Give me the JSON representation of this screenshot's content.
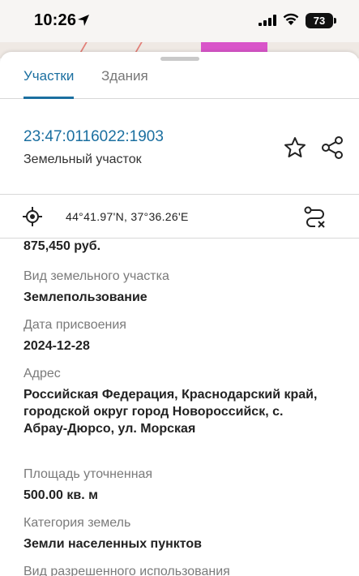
{
  "status_bar": {
    "time": "10:26",
    "battery": "73"
  },
  "tabs": [
    {
      "label": "Участки",
      "active": true
    },
    {
      "label": "Здания",
      "active": false
    }
  ],
  "parcel": {
    "cadastral_number": "23:47:0116022:1903",
    "object_type": "Земельный участок"
  },
  "coordinates": "44°41.97'N, 37°36.26'E",
  "details": {
    "cost_value": "875,450 руб.",
    "fields": [
      {
        "label": "Вид земельного участка",
        "value": "Землепользование"
      },
      {
        "label": "Дата присвоения",
        "value": "2024-12-28"
      },
      {
        "label": "Адрес",
        "value": "Российская Федерация, Краснодарский край, городской округ город Новороссийск, с. Абрау-Дюрсо, ул. Морская"
      },
      {
        "label": "Площадь уточненная",
        "value": "500.00 кв. м"
      },
      {
        "label": "Категория земель",
        "value": "Земли населенных пунктов"
      },
      {
        "label": "Вид разрешенного использования",
        "value": ""
      }
    ]
  },
  "colors": {
    "accent": "#1b6fa0",
    "map_parcel": "#d955c9"
  },
  "icons": [
    "location-arrow-icon",
    "signal-icon",
    "wifi-icon",
    "battery-icon",
    "star-icon",
    "share-icon",
    "locate-icon",
    "route-clear-icon"
  ]
}
